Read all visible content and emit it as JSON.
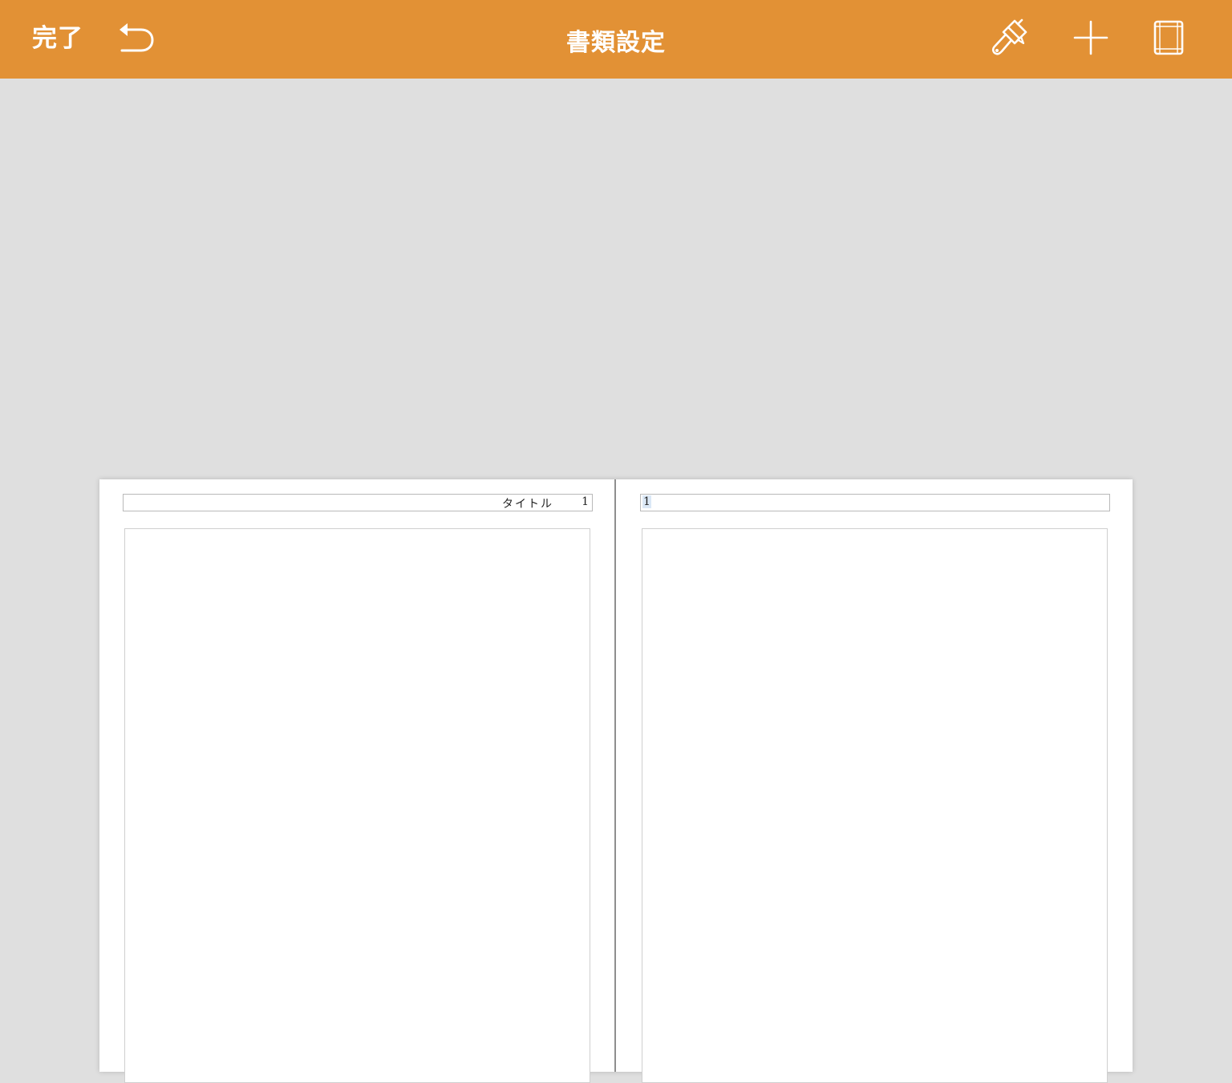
{
  "toolbar": {
    "done_label": "完了",
    "title": "書類設定",
    "background_color": "#e29135",
    "icons": {
      "undo": "undo-arrow-icon",
      "format": "paintbrush-icon",
      "add": "plus-icon",
      "document": "document-setup-icon"
    }
  },
  "document": {
    "left_page": {
      "header_title": "タイトル",
      "page_number": "1"
    },
    "right_page": {
      "page_number": "1"
    }
  }
}
